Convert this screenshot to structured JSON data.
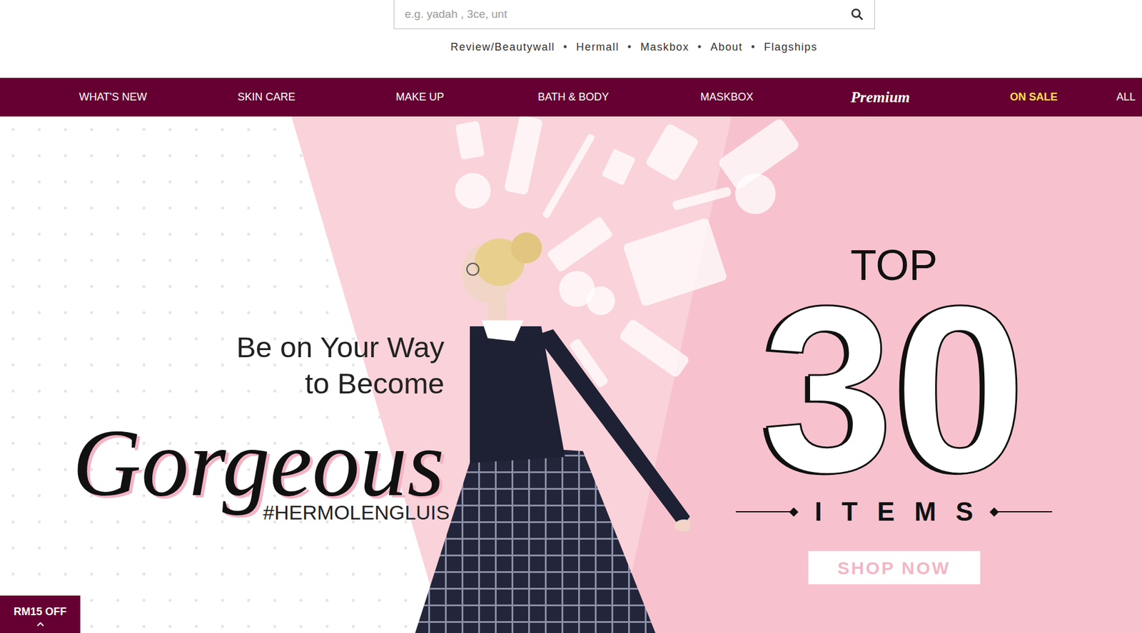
{
  "search": {
    "placeholder": "e.g. yadah , 3ce, unt"
  },
  "top_links": [
    "Review/Beautywall",
    "Hermall",
    "Maskbox",
    "About",
    "Flagships"
  ],
  "top_link_separator": "•",
  "nav": [
    {
      "label": "WHAT'S NEW",
      "kind": "normal"
    },
    {
      "label": "SKIN CARE",
      "kind": "normal"
    },
    {
      "label": "MAKE UP",
      "kind": "normal"
    },
    {
      "label": "BATH & BODY",
      "kind": "normal"
    },
    {
      "label": "MASKBOX",
      "kind": "normal"
    },
    {
      "label": "Premium",
      "kind": "premium"
    },
    {
      "label": "ON SALE",
      "kind": "sale"
    },
    {
      "label": "ALL",
      "kind": "normal"
    }
  ],
  "banner": {
    "tagline_1": "Be on Your Way",
    "tagline_2": "to Become",
    "headline": "Gorgeous",
    "hashtag": "#HERMOLENGLUIS",
    "top": "TOP",
    "count": "30",
    "items": "ITEMS",
    "button": "SHOP NOW"
  },
  "promo_badge": {
    "label": "RM15 OFF"
  }
}
